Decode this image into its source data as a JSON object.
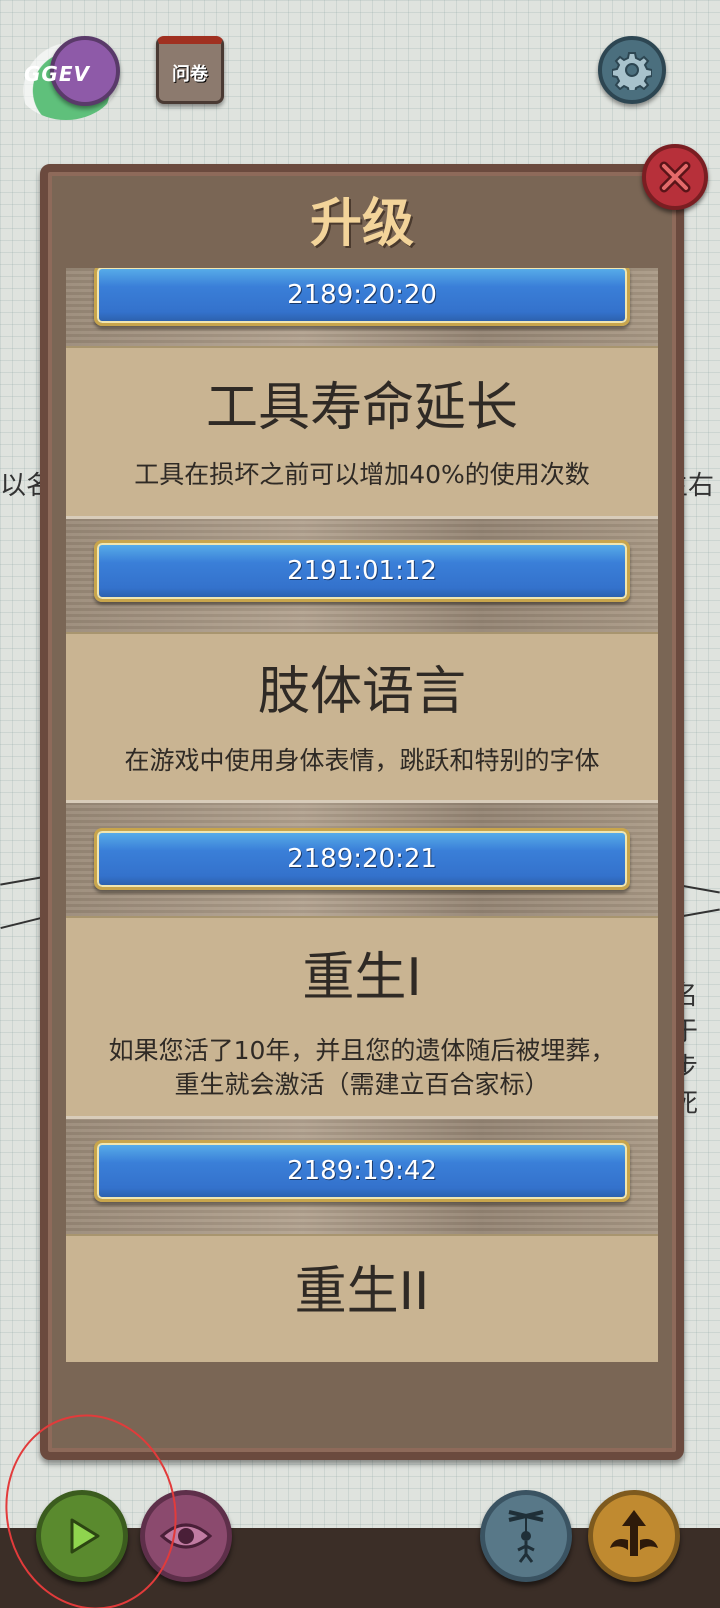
{
  "background": {
    "left_fragment": "以名",
    "right_fragment": "主右",
    "right_column": "名\n于\n步\n死"
  },
  "topbar": {
    "logo_text": "GGEV",
    "survey_label": "问卷",
    "settings_icon": "gear-icon"
  },
  "panel": {
    "title": "升级",
    "close_icon": "close-icon"
  },
  "items": [
    {
      "timer": "2189:20:20"
    },
    {
      "title": "工具寿命延长",
      "desc": "工具在损坏之前可以增加40%的使用次数",
      "timer": "2191:01:12"
    },
    {
      "title": "肢体语言",
      "desc": "在游戏中使用身体表情，跳跃和特别的字体",
      "timer": "2189:20:21"
    },
    {
      "title": "重生I",
      "desc_line1": "如果您活了10年，并且您的遗体随后被埋葬，",
      "desc_line2": "重生就会激活（需建立百合家标）",
      "timer": "2189:19:42"
    },
    {
      "title": "重生II"
    }
  ],
  "bottombar": {
    "play_icon": "play-icon",
    "eye_icon": "eye-icon",
    "puppet_icon": "puppet-icon",
    "upgrade_icon": "upgrade-arrow-icon"
  },
  "colors": {
    "timer_blue": "#3a7fd8",
    "panel_brown": "#7a6655",
    "card_tan": "#c9b492",
    "title_gold": "#f3d49a"
  }
}
